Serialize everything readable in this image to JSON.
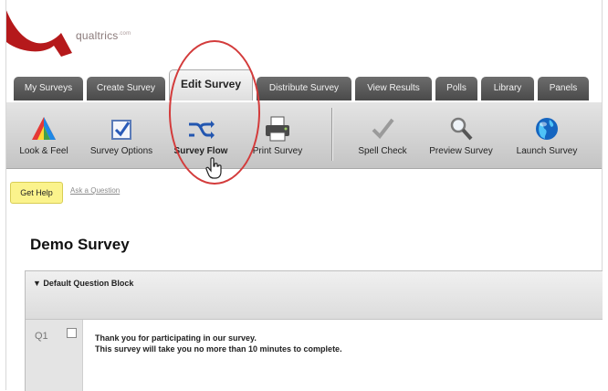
{
  "brand": {
    "logo_icon": "qualtrics-q-logo",
    "name": "qualtrics",
    "suffix": ".com",
    "accent_color": "#b5191b"
  },
  "tabs": [
    {
      "label": "My Surveys",
      "active": false
    },
    {
      "label": "Create Survey",
      "active": false
    },
    {
      "label": "Edit Survey",
      "active": true
    },
    {
      "label": "Distribute Survey",
      "active": false
    },
    {
      "label": "View Results",
      "active": false
    },
    {
      "label": "Polls",
      "active": false
    },
    {
      "label": "Library",
      "active": false
    },
    {
      "label": "Panels",
      "active": false
    }
  ],
  "toolbar": {
    "look_feel": {
      "label": "Look & Feel",
      "icon": "color-triangle-icon"
    },
    "survey_options": {
      "label": "Survey Options",
      "icon": "checkbox-icon"
    },
    "survey_flow": {
      "label": "Survey Flow",
      "icon": "flow-arrows-icon"
    },
    "print_survey": {
      "label": "Print Survey",
      "icon": "printer-icon"
    },
    "spell_check": {
      "label": "Spell Check",
      "icon": "checkmark-icon"
    },
    "preview_survey": {
      "label": "Preview Survey",
      "icon": "magnifier-icon"
    },
    "launch_survey": {
      "label": "Launch Survey",
      "icon": "globe-icon"
    }
  },
  "help": {
    "get_help": "Get Help",
    "ask_question": "Ask a Question"
  },
  "survey": {
    "title": "Demo Survey",
    "block_label": "▼ Default Question Block",
    "question": {
      "number": "Q1",
      "line1": "Thank you for participating in our survey.",
      "line2": "This survey will take you no more than 10 minutes to complete."
    }
  },
  "annotation": {
    "highlight_color": "#d33b3b"
  }
}
